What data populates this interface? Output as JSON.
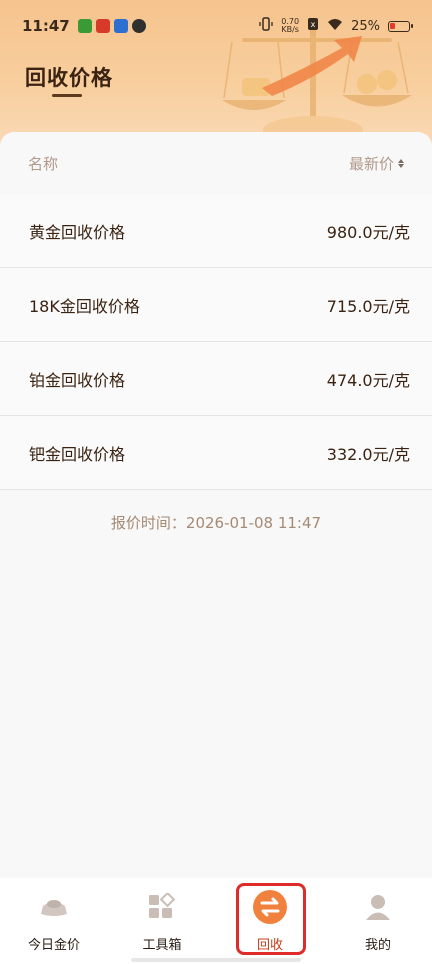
{
  "status_bar": {
    "time": "11:47",
    "net_speed_value": "0.70",
    "net_speed_unit": "KB/s",
    "battery": "25%",
    "app_icon_colors": [
      "#3a9a36",
      "#d83a2a",
      "#2d6fd1",
      "#2f2f2f"
    ]
  },
  "page": {
    "title": "回收价格"
  },
  "table": {
    "header_name": "名称",
    "header_price": "最新价",
    "rows": [
      {
        "name": "黄金回收价格",
        "price": "980.0元/克"
      },
      {
        "name": "18K金回收价格",
        "price": "715.0元/克"
      },
      {
        "name": "铂金回收价格",
        "price": "474.0元/克"
      },
      {
        "name": "钯金回收价格",
        "price": "332.0元/克"
      }
    ]
  },
  "quote_time": "报价时间：2026-01-08 11:47",
  "bottom_nav": {
    "items": [
      {
        "label": "今日金价",
        "icon": "gold-ingot-icon"
      },
      {
        "label": "工具箱",
        "icon": "toolbox-grid-icon"
      },
      {
        "label": "回收",
        "icon": "recycle-swap-icon",
        "active": true
      },
      {
        "label": "我的",
        "icon": "user-icon"
      }
    ],
    "accent_color": "#f0823e",
    "highlight_color": "#e02b2b"
  }
}
